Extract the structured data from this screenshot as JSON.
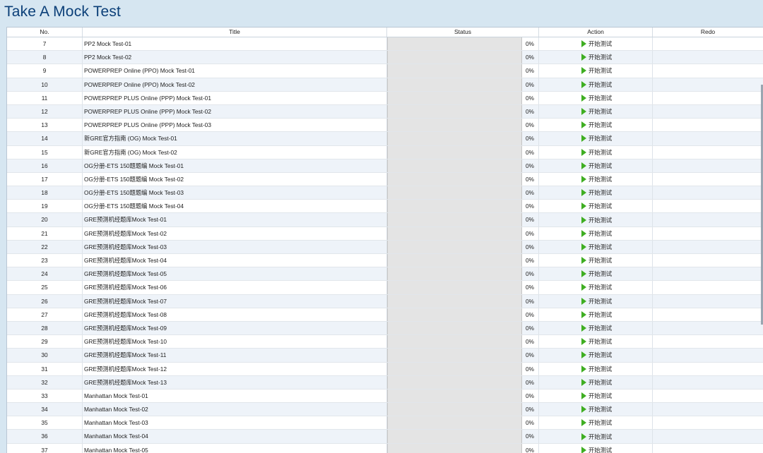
{
  "page": {
    "title": "Take A Mock Test"
  },
  "table": {
    "columns": {
      "no": "No.",
      "title": "Title",
      "status": "Status",
      "action": "Action",
      "redo": "Redo"
    },
    "rows": [
      {
        "no": "7",
        "title": "PP2 Mock Test-01",
        "progress": 0,
        "percent": "0%",
        "action": "开始测试",
        "redo": ""
      },
      {
        "no": "8",
        "title": "PP2 Mock Test-02",
        "progress": 0,
        "percent": "0%",
        "action": "开始测试",
        "redo": ""
      },
      {
        "no": "9",
        "title": "POWERPREP Online (PPO) Mock Test-01",
        "progress": 0,
        "percent": "0%",
        "action": "开始测试",
        "redo": ""
      },
      {
        "no": "10",
        "title": "POWERPREP Online (PPO) Mock Test-02",
        "progress": 0,
        "percent": "0%",
        "action": "开始测试",
        "redo": ""
      },
      {
        "no": "11",
        "title": "POWERPREP PLUS Online (PPP) Mock Test-01",
        "progress": 0,
        "percent": "0%",
        "action": "开始测试",
        "redo": ""
      },
      {
        "no": "12",
        "title": "POWERPREP PLUS Online (PPP) Mock Test-02",
        "progress": 0,
        "percent": "0%",
        "action": "开始测试",
        "redo": ""
      },
      {
        "no": "13",
        "title": "POWERPREP PLUS Online (PPP) Mock Test-03",
        "progress": 0,
        "percent": "0%",
        "action": "开始测试",
        "redo": ""
      },
      {
        "no": "14",
        "title": "新GRE官方指南 (OG) Mock Test-01",
        "progress": 0,
        "percent": "0%",
        "action": "开始测试",
        "redo": ""
      },
      {
        "no": "15",
        "title": "新GRE官方指南 (OG) Mock Test-02",
        "progress": 0,
        "percent": "0%",
        "action": "开始测试",
        "redo": ""
      },
      {
        "no": "16",
        "title": "OG分册-ETS 150题题编 Mock Test-01",
        "progress": 0,
        "percent": "0%",
        "action": "开始测试",
        "redo": ""
      },
      {
        "no": "17",
        "title": "OG分册-ETS 150题题编 Mock Test-02",
        "progress": 0,
        "percent": "0%",
        "action": "开始测试",
        "redo": ""
      },
      {
        "no": "18",
        "title": "OG分册-ETS 150题题编 Mock Test-03",
        "progress": 0,
        "percent": "0%",
        "action": "开始测试",
        "redo": ""
      },
      {
        "no": "19",
        "title": "OG分册-ETS 150题题编 Mock Test-04",
        "progress": 0,
        "percent": "0%",
        "action": "开始测试",
        "redo": ""
      },
      {
        "no": "20",
        "title": "GRE预测机经题库Mock Test-01",
        "progress": 0,
        "percent": "0%",
        "action": "开始测试",
        "redo": ""
      },
      {
        "no": "21",
        "title": "GRE预测机经题库Mock Test-02",
        "progress": 0,
        "percent": "0%",
        "action": "开始测试",
        "redo": ""
      },
      {
        "no": "22",
        "title": "GRE预测机经题库Mock Test-03",
        "progress": 0,
        "percent": "0%",
        "action": "开始测试",
        "redo": ""
      },
      {
        "no": "23",
        "title": "GRE预测机经题库Mock Test-04",
        "progress": 0,
        "percent": "0%",
        "action": "开始测试",
        "redo": ""
      },
      {
        "no": "24",
        "title": "GRE预测机经题库Mock Test-05",
        "progress": 0,
        "percent": "0%",
        "action": "开始测试",
        "redo": ""
      },
      {
        "no": "25",
        "title": "GRE预测机经题库Mock Test-06",
        "progress": 0,
        "percent": "0%",
        "action": "开始测试",
        "redo": ""
      },
      {
        "no": "26",
        "title": "GRE预测机经题库Mock Test-07",
        "progress": 0,
        "percent": "0%",
        "action": "开始测试",
        "redo": ""
      },
      {
        "no": "27",
        "title": "GRE预测机经题库Mock Test-08",
        "progress": 0,
        "percent": "0%",
        "action": "开始测试",
        "redo": ""
      },
      {
        "no": "28",
        "title": "GRE预测机经题库Mock Test-09",
        "progress": 0,
        "percent": "0%",
        "action": "开始测试",
        "redo": ""
      },
      {
        "no": "29",
        "title": "GRE预测机经题库Mock Test-10",
        "progress": 0,
        "percent": "0%",
        "action": "开始测试",
        "redo": ""
      },
      {
        "no": "30",
        "title": "GRE预测机经题库Mock Test-11",
        "progress": 0,
        "percent": "0%",
        "action": "开始测试",
        "redo": ""
      },
      {
        "no": "31",
        "title": "GRE预测机经题库Mock Test-12",
        "progress": 0,
        "percent": "0%",
        "action": "开始测试",
        "redo": ""
      },
      {
        "no": "32",
        "title": "GRE预测机经题库Mock Test-13",
        "progress": 0,
        "percent": "0%",
        "action": "开始测试",
        "redo": ""
      },
      {
        "no": "33",
        "title": "Manhattan Mock Test-01",
        "progress": 0,
        "percent": "0%",
        "action": "开始测试",
        "redo": ""
      },
      {
        "no": "34",
        "title": "Manhattan Mock Test-02",
        "progress": 0,
        "percent": "0%",
        "action": "开始测试",
        "redo": ""
      },
      {
        "no": "35",
        "title": "Manhattan Mock Test-03",
        "progress": 0,
        "percent": "0%",
        "action": "开始测试",
        "redo": ""
      },
      {
        "no": "36",
        "title": "Manhattan Mock Test-04",
        "progress": 0,
        "percent": "0%",
        "action": "开始测试",
        "redo": ""
      },
      {
        "no": "37",
        "title": "Manhattan Mock Test-05",
        "progress": 0,
        "percent": "0%",
        "action": "开始测试",
        "redo": ""
      }
    ]
  },
  "colors": {
    "header_bg": "#d6e6f1",
    "title_text": "#0b3f78",
    "play_icon": "#3fae22",
    "row_alt": "#eef3f9"
  },
  "icons": {
    "action": "play-icon"
  }
}
